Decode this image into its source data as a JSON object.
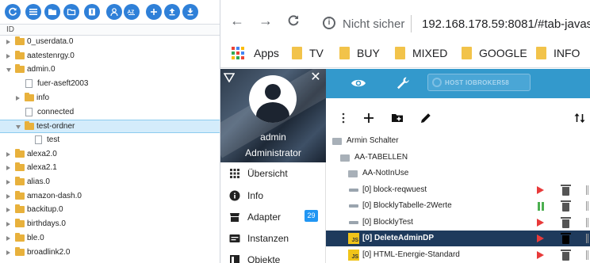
{
  "left_panel": {
    "toolbar": [
      {
        "name": "refresh",
        "icon": "refresh-icon"
      },
      {
        "name": "list-view",
        "icon": "list-icon"
      },
      {
        "name": "folder-view",
        "icon": "folder-icon"
      },
      {
        "name": "folder-closed",
        "icon": "folder-outline-icon"
      },
      {
        "name": "info",
        "icon": "info-square-icon"
      },
      {
        "name": "user",
        "icon": "user-icon"
      },
      {
        "name": "sort",
        "icon": "sort-az-icon"
      },
      {
        "name": "add",
        "icon": "plus-icon"
      },
      {
        "name": "upload",
        "icon": "upload-icon"
      },
      {
        "name": "download",
        "icon": "download-icon"
      }
    ],
    "column_header": "ID",
    "tree": [
      {
        "label": "0_userdata.0",
        "state": "collapsed",
        "level": 0,
        "type": "folder"
      },
      {
        "label": "aatestenrgy.0",
        "state": "collapsed",
        "level": 0,
        "type": "folder"
      },
      {
        "label": "admin.0",
        "state": "expanded",
        "level": 0,
        "type": "folder"
      },
      {
        "label": "fuer-aseft2003",
        "state": "none",
        "level": 1,
        "type": "file"
      },
      {
        "label": "info",
        "state": "collapsed",
        "level": 1,
        "type": "folder"
      },
      {
        "label": "connected",
        "state": "none",
        "level": 1,
        "type": "file"
      },
      {
        "label": "test-ordner",
        "state": "expanded",
        "level": 1,
        "type": "folder",
        "selected": true
      },
      {
        "label": "test",
        "state": "none",
        "level": 2,
        "type": "file"
      },
      {
        "label": "alexa2.0",
        "state": "collapsed",
        "level": 0,
        "type": "folder"
      },
      {
        "label": "alexa2.1",
        "state": "collapsed",
        "level": 0,
        "type": "folder"
      },
      {
        "label": "alias.0",
        "state": "collapsed",
        "level": 0,
        "type": "folder"
      },
      {
        "label": "amazon-dash.0",
        "state": "collapsed",
        "level": 0,
        "type": "folder"
      },
      {
        "label": "backitup.0",
        "state": "collapsed",
        "level": 0,
        "type": "folder"
      },
      {
        "label": "birthdays.0",
        "state": "collapsed",
        "level": 0,
        "type": "folder"
      },
      {
        "label": "ble.0",
        "state": "collapsed",
        "level": 0,
        "type": "folder"
      },
      {
        "label": "broadlink2.0",
        "state": "collapsed",
        "level": 0,
        "type": "folder"
      }
    ]
  },
  "browser": {
    "security_text": "Nicht sicher",
    "url": "192.168.178.59:8081/#tab-javas",
    "bookmarks": [
      {
        "label": "Apps",
        "icon": "apps-grid-icon"
      },
      {
        "label": "TV",
        "icon": "folder-icon"
      },
      {
        "label": "BUY",
        "icon": "folder-icon"
      },
      {
        "label": "MIXED",
        "icon": "folder-icon"
      },
      {
        "label": "GOOGLE",
        "icon": "folder-icon"
      },
      {
        "label": "INFO",
        "icon": "folder-icon"
      }
    ]
  },
  "admin": {
    "user_name": "admin",
    "user_role": "Administrator",
    "host_label": "HOST IOBROKER58",
    "menu": [
      {
        "label": "Übersicht",
        "icon": "grid-icon"
      },
      {
        "label": "Info",
        "icon": "info-icon"
      },
      {
        "label": "Adapter",
        "icon": "store-icon",
        "badge": "29"
      },
      {
        "label": "Instanzen",
        "icon": "instances-icon"
      },
      {
        "label": "Objekte",
        "icon": "objects-icon"
      }
    ],
    "scripts": [
      {
        "label": "Armin Schalter",
        "kind": "folder-open",
        "level": 0
      },
      {
        "label": "AA-TABELLEN",
        "kind": "folder-open",
        "level": 1
      },
      {
        "label": "AA-NotInUse",
        "kind": "folder",
        "level": 2
      },
      {
        "label": "[0] block-reqwuest",
        "kind": "blockly",
        "level": 2,
        "status": "stopped"
      },
      {
        "label": "[0] BlocklyTabelle-2Werte",
        "kind": "blockly",
        "level": 2,
        "status": "running"
      },
      {
        "label": "[0] BlocklyTest",
        "kind": "blockly",
        "level": 2,
        "status": "stopped"
      },
      {
        "label": "[0] DeleteAdminDP",
        "kind": "js",
        "level": 2,
        "status": "stopped",
        "active": true
      },
      {
        "label": "[0] HTML-Energie-Standard",
        "kind": "js",
        "level": 2,
        "status": "stopped"
      }
    ]
  },
  "colors": {
    "toolbar_blue": "#2f80d8",
    "admin_blue": "#3399cc",
    "selected_row": "#d4ecfb",
    "active_row": "#1e3a5c",
    "play_red": "#e83a3a",
    "pause_green": "#4caf50",
    "folder_yellow": "#e8b13c",
    "js_yellow": "#f0c419"
  }
}
